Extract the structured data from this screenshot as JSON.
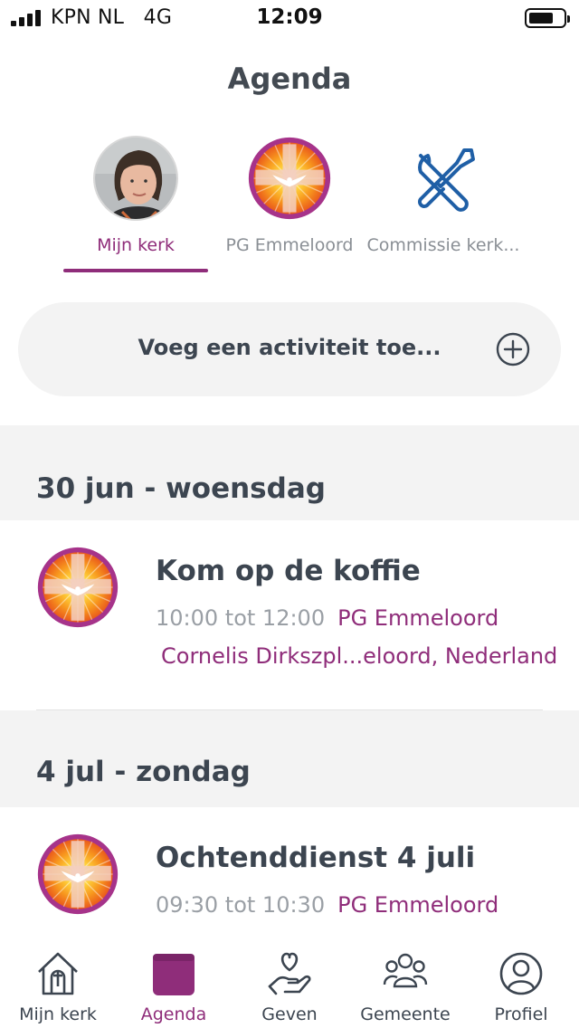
{
  "status_bar": {
    "carrier": "KPN NL",
    "network": "4G",
    "time": "12:09",
    "battery_level": 0.72
  },
  "header": {
    "title": "Agenda"
  },
  "tabs": [
    {
      "label": "Mijn kerk",
      "icon": "user-photo-avatar",
      "active": true
    },
    {
      "label": "PG Emmeloord",
      "icon": "church-logo-icon",
      "active": false
    },
    {
      "label": "Commissie kerk...",
      "icon": "tools-icon",
      "active": false
    }
  ],
  "add_activity": {
    "label": "Voeg een activiteit toe...",
    "icon": "plus-circle-icon"
  },
  "agenda": [
    {
      "date": "30 jun - woensdag",
      "events": [
        {
          "title": "Kom op de koffie",
          "time": "10:00 tot 12:00",
          "organization": "PG Emmeloord",
          "location": "Cornelis Dirkszpl...eloord, Nederland"
        }
      ]
    },
    {
      "date": "4 jul - zondag",
      "events": [
        {
          "title": "Ochtenddienst 4 juli",
          "time": "09:30 tot 10:30",
          "organization": "PG Emmeloord"
        }
      ]
    }
  ],
  "bottom_nav": [
    {
      "label": "Mijn kerk",
      "icon": "church-house-icon",
      "active": false
    },
    {
      "label": "Agenda",
      "icon": "calendar-icon",
      "active": true
    },
    {
      "label": "Geven",
      "icon": "heart-hand-icon",
      "active": false
    },
    {
      "label": "Gemeente",
      "icon": "people-group-icon",
      "active": false
    },
    {
      "label": "Profiel",
      "icon": "profile-icon",
      "active": false
    }
  ],
  "colors": {
    "accent": "#8f2d7a",
    "text": "#3c4550",
    "muted": "#9a9fa5",
    "tools_icon": "#1f5fa6",
    "list_background": "#f3f3f3"
  }
}
